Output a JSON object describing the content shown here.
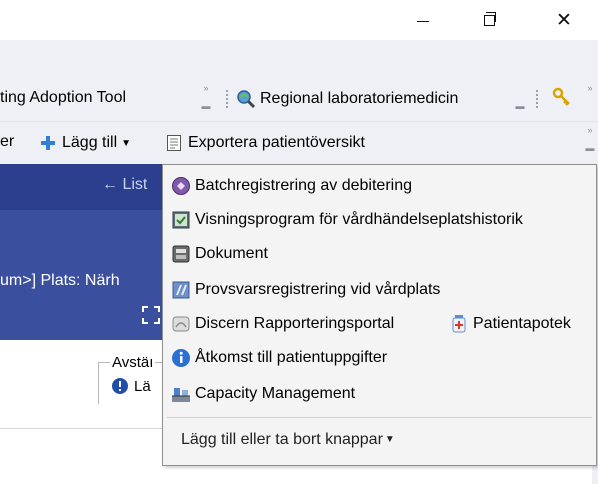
{
  "window": {
    "close_glyph": "✕"
  },
  "toolbar1": {
    "items": [
      {
        "label": "ting Adoption Tool"
      },
      {
        "label": "Regional laboratoriemedicin",
        "icon": "magnifier-globe-icon"
      }
    ]
  },
  "toolbar2": {
    "partial_label": "er",
    "add_label": "Lägg till",
    "export_label": "Exportera patientöversikt"
  },
  "header": {
    "list_label": "List",
    "location_text": "um>] Plats: Närh"
  },
  "lower": {
    "group_label": "Avstäı",
    "item_label": "Lä"
  },
  "menu": {
    "items": [
      {
        "label": "Batchregistrering av debitering",
        "icon": "batch-registration-icon"
      },
      {
        "label": "Visningsprogram för vårdhändelseplatshistorik",
        "icon": "viewer-program-icon"
      },
      {
        "label": "Dokument",
        "icon": "document-icon"
      },
      {
        "label": "Provsvarsregistrering vid vårdplats",
        "icon": "sample-results-icon"
      },
      {
        "label": "Discern Rapporteringsportal",
        "icon": "report-portal-icon"
      },
      {
        "label": "Åtkomst till patientuppgifter",
        "icon": "info-icon"
      },
      {
        "label": "Capacity Management",
        "icon": "capacity-management-icon"
      }
    ],
    "extra_item": {
      "label": "Patientapotek",
      "icon": "pharmacy-icon"
    },
    "footer_label": "Lägg till eller ta bort knappar"
  },
  "colors": {
    "header_dark": "#2c3f8f",
    "header_main": "#3b4f9f",
    "toolbar_bg": "#eef0f5",
    "menu_bg": "#f4f4f4"
  }
}
